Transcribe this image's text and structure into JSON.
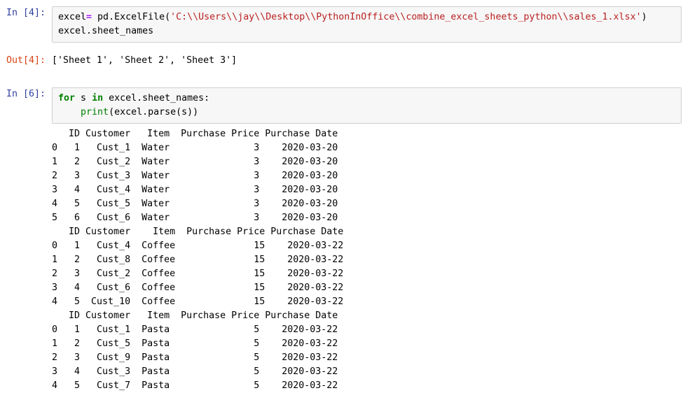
{
  "notebook": {
    "cells": [
      {
        "kind": "input",
        "prompt": "In [4]:",
        "name": "code-cell-1"
      },
      {
        "kind": "output",
        "prompt": "Out[4]:",
        "name": "output-cell-1"
      },
      {
        "kind": "input",
        "prompt": "In [6]:",
        "name": "code-cell-2"
      },
      {
        "kind": "output",
        "prompt": "",
        "name": "output-cell-2"
      }
    ]
  },
  "cell1": {
    "prompt": "In [4]:",
    "line1_var": "excel",
    "line1_op": "=",
    "line1_call": " pd.ExcelFile(",
    "line1_string": "'C:\\\\Users\\\\jay\\\\Desktop\\\\PythonInOffice\\\\combine_excel_sheets_python\\\\sales_1.xlsx'",
    "line1_close": ")",
    "line2": "excel.sheet_names"
  },
  "cell1_output": {
    "prompt": "Out[4]:",
    "text": "['Sheet 1', 'Sheet 2', 'Sheet 3']"
  },
  "cell2": {
    "prompt": "In [6]:",
    "kw_for": "for",
    "loop_var": " s ",
    "kw_in": "in",
    "iterable": " excel.sheet_names:",
    "line2_indent": "    ",
    "line2_fn": "print",
    "line2_args": "(excel.parse(s))"
  },
  "cell2_output": {
    "prompt": "",
    "tables": [
      {
        "name": "sheet-1-dataframe",
        "columns": [
          "ID",
          "Customer",
          "Item",
          "Purchase Price",
          "Purchase Date"
        ],
        "index": [
          "0",
          "1",
          "2",
          "3",
          "4",
          "5"
        ],
        "rows": [
          [
            "1",
            "Cust_1",
            "Water",
            "3",
            "2020-03-20"
          ],
          [
            "2",
            "Cust_2",
            "Water",
            "3",
            "2020-03-20"
          ],
          [
            "3",
            "Cust_3",
            "Water",
            "3",
            "2020-03-20"
          ],
          [
            "4",
            "Cust_4",
            "Water",
            "3",
            "2020-03-20"
          ],
          [
            "5",
            "Cust_5",
            "Water",
            "3",
            "2020-03-20"
          ],
          [
            "6",
            "Cust_6",
            "Water",
            "3",
            "2020-03-20"
          ]
        ],
        "text": "   ID Customer   Item  Purchase Price Purchase Date\n0   1   Cust_1  Water               3    2020-03-20\n1   2   Cust_2  Water               3    2020-03-20\n2   3   Cust_3  Water               3    2020-03-20\n3   4   Cust_4  Water               3    2020-03-20\n4   5   Cust_5  Water               3    2020-03-20\n5   6   Cust_6  Water               3    2020-03-20"
      },
      {
        "name": "sheet-2-dataframe",
        "columns": [
          "ID",
          "Customer",
          "Item",
          "Purchase Price",
          "Purchase Date"
        ],
        "index": [
          "0",
          "1",
          "2",
          "3",
          "4"
        ],
        "rows": [
          [
            "1",
            "Cust_4",
            "Coffee",
            "15",
            "2020-03-22"
          ],
          [
            "2",
            "Cust_8",
            "Coffee",
            "15",
            "2020-03-22"
          ],
          [
            "3",
            "Cust_2",
            "Coffee",
            "15",
            "2020-03-22"
          ],
          [
            "4",
            "Cust_6",
            "Coffee",
            "15",
            "2020-03-22"
          ],
          [
            "5",
            "Cust_10",
            "Coffee",
            "15",
            "2020-03-22"
          ]
        ],
        "text": "   ID Customer    Item  Purchase Price Purchase Date\n0   1   Cust_4  Coffee              15    2020-03-22\n1   2   Cust_8  Coffee              15    2020-03-22\n2   3   Cust_2  Coffee              15    2020-03-22\n3   4   Cust_6  Coffee              15    2020-03-22\n4   5  Cust_10  Coffee              15    2020-03-22"
      },
      {
        "name": "sheet-3-dataframe",
        "columns": [
          "ID",
          "Customer",
          "Item",
          "Purchase Price",
          "Purchase Date"
        ],
        "index": [
          "0",
          "1",
          "2",
          "3",
          "4"
        ],
        "rows": [
          [
            "1",
            "Cust_1",
            "Pasta",
            "5",
            "2020-03-22"
          ],
          [
            "2",
            "Cust_5",
            "Pasta",
            "5",
            "2020-03-22"
          ],
          [
            "3",
            "Cust_9",
            "Pasta",
            "5",
            "2020-03-22"
          ],
          [
            "4",
            "Cust_3",
            "Pasta",
            "5",
            "2020-03-22"
          ],
          [
            "5",
            "Cust_7",
            "Pasta",
            "5",
            "2020-03-22"
          ]
        ],
        "text": "   ID Customer   Item  Purchase Price Purchase Date\n0   1   Cust_1  Pasta               5    2020-03-22\n1   2   Cust_5  Pasta               5    2020-03-22\n2   3   Cust_9  Pasta               5    2020-03-22\n3   4   Cust_3  Pasta               5    2020-03-22\n4   5   Cust_7  Pasta               5    2020-03-22"
      }
    ]
  },
  "colors": {
    "prompt_in": "#303f9f",
    "prompt_out": "#d84315",
    "string": "#ba2121",
    "keyword": "#008000",
    "operator": "#aa22ff",
    "cell_bg": "#f7f7f7",
    "cell_border": "#cfcfcf",
    "text": "#000000"
  }
}
